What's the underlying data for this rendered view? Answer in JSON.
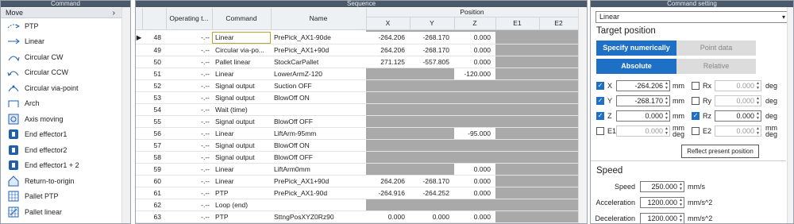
{
  "command_panel": {
    "title": "Command",
    "category": "Move",
    "items": [
      {
        "label": "PTP",
        "icon": "ptp-icon"
      },
      {
        "label": "Linear",
        "icon": "linear-icon"
      },
      {
        "label": "Circular CW",
        "icon": "circular-cw-icon"
      },
      {
        "label": "Circular CCW",
        "icon": "circular-ccw-icon"
      },
      {
        "label": "Circular via-point",
        "icon": "circular-via-point-icon"
      },
      {
        "label": "Arch",
        "icon": "arch-icon"
      },
      {
        "label": "Axis moving",
        "icon": "axis-moving-icon"
      },
      {
        "label": "End effector1",
        "icon": "end-effector-icon"
      },
      {
        "label": "End effector2",
        "icon": "end-effector-icon"
      },
      {
        "label": "End effector1 + 2",
        "icon": "end-effector-icon"
      },
      {
        "label": "Return-to-origin",
        "icon": "home-icon"
      },
      {
        "label": "Pallet PTP",
        "icon": "pallet-ptp-icon"
      },
      {
        "label": "Pallet linear",
        "icon": "pallet-linear-icon"
      }
    ]
  },
  "sequence_panel": {
    "title": "Sequence",
    "headers": {
      "operating_time": "Operating t...",
      "command": "Command",
      "name": "Name",
      "position": "Position",
      "x": "X",
      "y": "Y",
      "z": "Z",
      "e1": "E1",
      "e2": "E2"
    },
    "rows": [
      {
        "num": "48",
        "time": "-.--",
        "command": "Linear",
        "name": "PrePick_AX1-90de",
        "x": "-264.206",
        "y": "-268.170",
        "z": "0.000",
        "gray": "e",
        "selected": true
      },
      {
        "num": "49",
        "time": "-.--",
        "command": "Circular via-po...",
        "name": "PrePick_AX1+90d",
        "x": "264.206",
        "y": "-268.170",
        "z": "0.000",
        "gray": "e"
      },
      {
        "num": "50",
        "time": "-.--",
        "command": "Pallet linear",
        "name": "StockCarPallet",
        "x": "271.125",
        "y": "-557.805",
        "z": "0.000",
        "gray": "e"
      },
      {
        "num": "51",
        "time": "-.--",
        "command": "Linear",
        "name": "LowerArmZ-120",
        "x": "",
        "y": "",
        "z": "-120.000",
        "gray": "xye"
      },
      {
        "num": "52",
        "time": "-.--",
        "command": "Signal output",
        "name": "Suction OFF",
        "x": "",
        "y": "",
        "z": "",
        "gray": "all"
      },
      {
        "num": "53",
        "time": "-.--",
        "command": "Signal output",
        "name": "BlowOff ON",
        "x": "",
        "y": "",
        "z": "",
        "gray": "all"
      },
      {
        "num": "54",
        "time": "-.--",
        "command": "Wait (time)",
        "name": "",
        "x": "",
        "y": "",
        "z": "",
        "gray": "all"
      },
      {
        "num": "55",
        "time": "-.--",
        "command": "Signal output",
        "name": "BlowOff OFF",
        "x": "",
        "y": "",
        "z": "",
        "gray": "all"
      },
      {
        "num": "56",
        "time": "-.--",
        "command": "Linear",
        "name": "LiftArm-95mm",
        "x": "",
        "y": "",
        "z": "-95.000",
        "gray": "xye"
      },
      {
        "num": "57",
        "time": "-.--",
        "command": "Signal output",
        "name": "BlowOff ON",
        "x": "",
        "y": "",
        "z": "",
        "gray": "all"
      },
      {
        "num": "58",
        "time": "-.--",
        "command": "Signal output",
        "name": "BlowOff OFF",
        "x": "",
        "y": "",
        "z": "",
        "gray": "all"
      },
      {
        "num": "59",
        "time": "-.--",
        "command": "Linear",
        "name": "LiftArm0mm",
        "x": "",
        "y": "",
        "z": "0.000",
        "gray": "xye"
      },
      {
        "num": "60",
        "time": "-.--",
        "command": "Linear",
        "name": "PrePick_AX1+90d",
        "x": "264.206",
        "y": "-268.170",
        "z": "0.000",
        "gray": "e"
      },
      {
        "num": "61",
        "time": "-.--",
        "command": "PTP",
        "name": "PrePick_AX1-90d",
        "x": "-264.916",
        "y": "-264.252",
        "z": "0.000",
        "gray": "e"
      },
      {
        "num": "62",
        "time": "-.--",
        "command": "Loop (end)",
        "name": "",
        "x": "",
        "y": "",
        "z": "",
        "gray": "all"
      },
      {
        "num": "63",
        "time": "-.--",
        "command": "PTP",
        "name": "SttngPosXYZ0Rz90",
        "x": "0.000",
        "y": "0.000",
        "z": "0.000",
        "gray": "e"
      }
    ]
  },
  "settings_panel": {
    "title": "Command setting",
    "command_select": "Linear",
    "target_position_heading": "Target position",
    "mode_tabs": {
      "numeric": "Specify numerically",
      "point": "Point data"
    },
    "coord_tabs": {
      "absolute": "Absolute",
      "relative": "Relative"
    },
    "axes": [
      {
        "label": "X",
        "value": "-264.206",
        "unit": "mm",
        "checked": true,
        "r_label": "Rx",
        "r_value": "0.000",
        "r_unit": "deg",
        "r_checked": false
      },
      {
        "label": "Y",
        "value": "-268.170",
        "unit": "mm",
        "checked": true,
        "r_label": "Ry",
        "r_value": "0.000",
        "r_unit": "deg",
        "r_checked": false
      },
      {
        "label": "Z",
        "value": "0.000",
        "unit": "mm",
        "checked": true,
        "r_label": "Rz",
        "r_value": "0.000",
        "r_unit": "deg",
        "r_checked": true
      },
      {
        "label": "E1",
        "value": "0.000",
        "unit": "mm deg",
        "checked": false,
        "r_label": "E2",
        "r_value": "0.000",
        "r_unit": "mm deg",
        "r_checked": false
      }
    ],
    "reflect_button": "Reflect present position",
    "speed_heading": "Speed",
    "speed": [
      {
        "label": "Speed",
        "value": "250.000",
        "unit": "mm/s"
      },
      {
        "label": "Acceleration",
        "value": "1200.000",
        "unit": "mm/s^2"
      },
      {
        "label": "Deceleration",
        "value": "1200.000",
        "unit": "mm/s^2"
      }
    ]
  }
}
